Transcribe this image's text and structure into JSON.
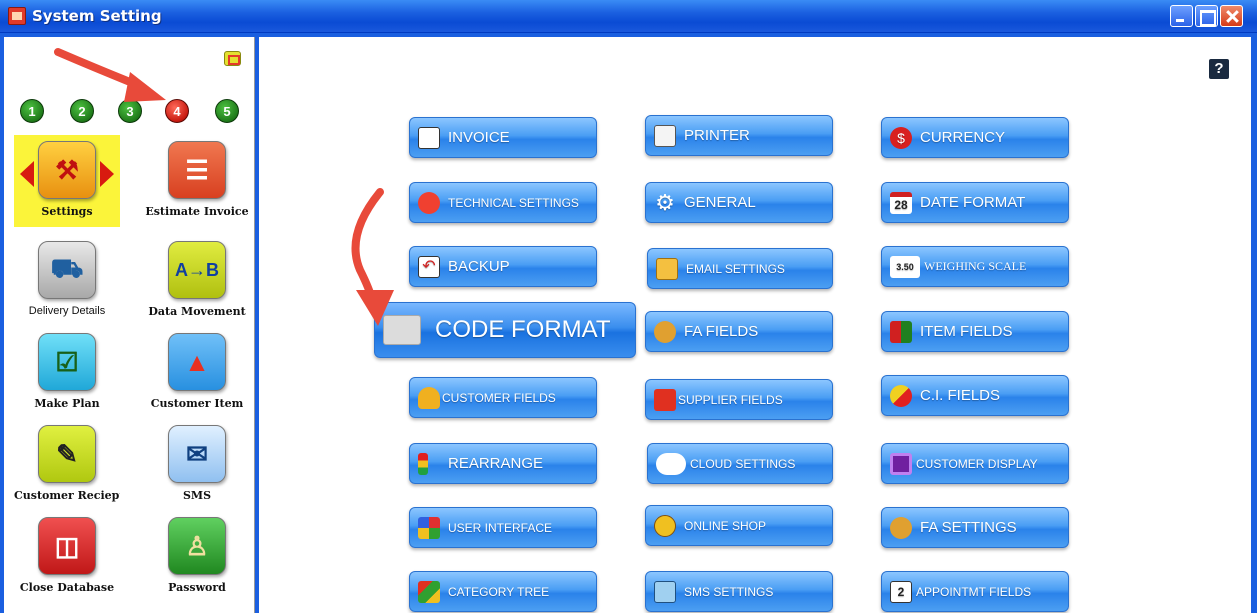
{
  "window": {
    "title": "System Setting"
  },
  "sidebar": {
    "pages": [
      "1",
      "2",
      "3",
      "4",
      "5"
    ],
    "active_page": "4",
    "items": [
      {
        "label": "Settings",
        "icon": "settings-tools-icon",
        "color": "#f0a020",
        "selected": true
      },
      {
        "label": "Estimate Invoice",
        "icon": "estimate-invoice-icon",
        "color": "#e85a30"
      },
      {
        "label": "Delivery Details",
        "icon": "delivery-truck-icon",
        "color": "#b8b8b8"
      },
      {
        "label": "Data Movement",
        "icon": "data-movement-icon",
        "color": "#c8d820"
      },
      {
        "label": "Make Plan",
        "icon": "make-plan-icon",
        "color": "#40c0e0"
      },
      {
        "label": "Customer Item",
        "icon": "customer-item-icon",
        "color": "#40a0e8"
      },
      {
        "label": "Customer Reciept",
        "icon": "customer-receipt-icon",
        "color": "#c0d820"
      },
      {
        "label": "SMS",
        "icon": "sms-icon",
        "color": "#a0c8f0"
      },
      {
        "label": "Close Database",
        "icon": "close-database-icon",
        "color": "#e03030"
      },
      {
        "label": "Password",
        "icon": "password-user-icon",
        "color": "#30a030"
      }
    ]
  },
  "main": {
    "help": "?",
    "buttons": [
      {
        "label": "INVOICE",
        "icon": "invoice-icon"
      },
      {
        "label": "PRINTER",
        "icon": "printer-icon"
      },
      {
        "label": "CURRENCY",
        "icon": "currency-icon"
      },
      {
        "label": "TECHNICAL SETTINGS",
        "icon": "technical-settings-icon"
      },
      {
        "label": "GENERAL",
        "icon": "gear-icon"
      },
      {
        "label": "DATE FORMAT",
        "icon": "calendar-icon",
        "icon_text": "28"
      },
      {
        "label": "BACKUP",
        "icon": "backup-arrow-icon"
      },
      {
        "label": "EMAIL SETTINGS",
        "icon": "email-icon"
      },
      {
        "label": "WEIGHING SCALE",
        "icon": "weighing-scale-icon",
        "icon_text": "3.50"
      },
      {
        "label": "CODE FORMAT",
        "icon": "code-format-icon"
      },
      {
        "label": "FA FIELDS",
        "icon": "fa-fields-icon"
      },
      {
        "label": "ITEM FIELDS",
        "icon": "item-fields-icon"
      },
      {
        "label": "CUSTOMER FIELDS",
        "icon": "customer-fields-icon"
      },
      {
        "label": "SUPPLIER FIELDS",
        "icon": "supplier-truck-icon"
      },
      {
        "label": "C.I. FIELDS",
        "icon": "ci-fields-icon"
      },
      {
        "label": "REARRANGE",
        "icon": "rearrange-icon"
      },
      {
        "label": "CLOUD SETTINGS",
        "icon": "cloud-icon"
      },
      {
        "label": "CUSTOMER DISPLAY",
        "icon": "customer-display-icon"
      },
      {
        "label": "USER INTERFACE",
        "icon": "user-interface-icon"
      },
      {
        "label": "ONLINE SHOP",
        "icon": "globe-icon"
      },
      {
        "label": "FA SETTINGS",
        "icon": "fa-settings-icon"
      },
      {
        "label": "CATEGORY TREE",
        "icon": "category-tree-icon"
      },
      {
        "label": "SMS SETTINGS",
        "icon": "sms-settings-icon"
      },
      {
        "label": "APPOINTMT FIELDS",
        "icon": "appointment-calendar-icon",
        "icon_text": "2"
      }
    ]
  },
  "colors": {
    "title_bar": "#1a5fe0",
    "button": "#4a9ef4",
    "selected": "#fbf43a",
    "annotation_arrow": "#e84a3a"
  }
}
